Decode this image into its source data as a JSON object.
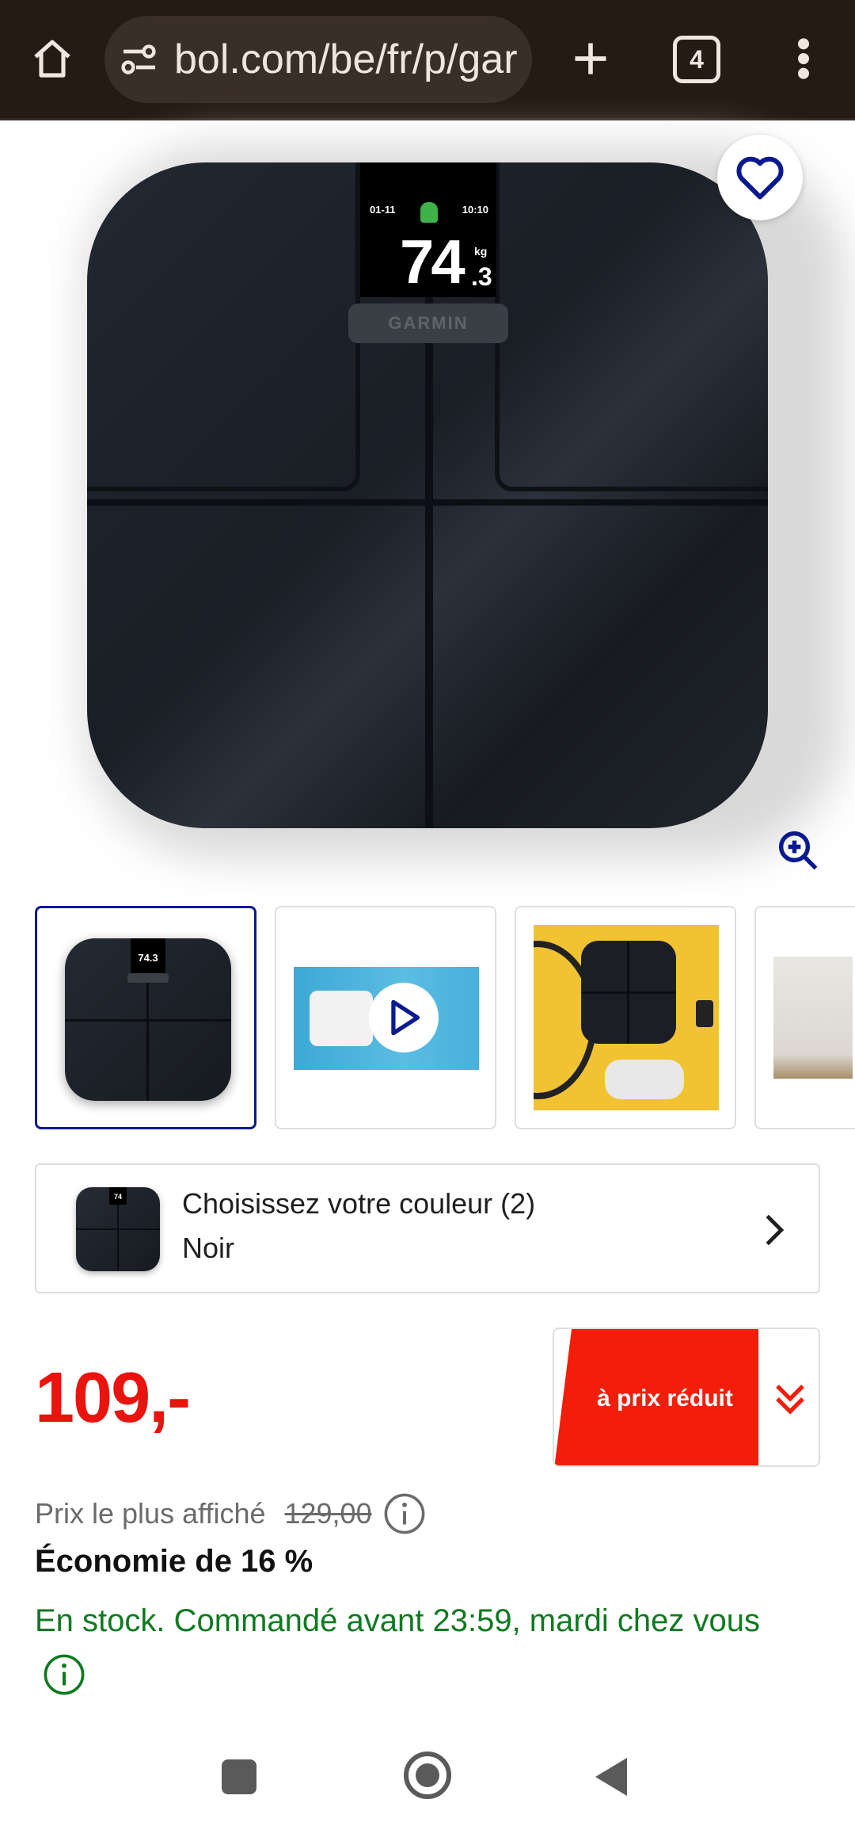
{
  "browser": {
    "url": "bol.com/be/fr/p/gar",
    "tab_count": "4",
    "icons": [
      "home-icon",
      "site-settings-icon",
      "plus-icon",
      "tabs-icon",
      "more-vert-icon"
    ]
  },
  "product_image": {
    "display_date": "01-11",
    "display_time": "10:10",
    "display_weight": "74",
    "display_decimal": ".3",
    "display_unit": "kg",
    "logo_text": "GARMIN",
    "thumb_display": "74.3"
  },
  "colour_selector": {
    "title": "Choisissez votre couleur (2)",
    "value": "Noir",
    "swatch_display": "74"
  },
  "pricing": {
    "price": "109,-",
    "promo_label": "à prix réduit",
    "was_label": "Prix le plus affiché",
    "was_price": "129,00",
    "saving": "Économie de 16 %",
    "stock": "En stock. Commandé avant 23:59, mardi chez vous"
  },
  "colors": {
    "price_red": "#e8140d",
    "promo_red": "#f21e0a",
    "stock_green": "#0f7a1f",
    "accent_blue": "#0a1a8e",
    "browser_bg": "#241b15"
  }
}
